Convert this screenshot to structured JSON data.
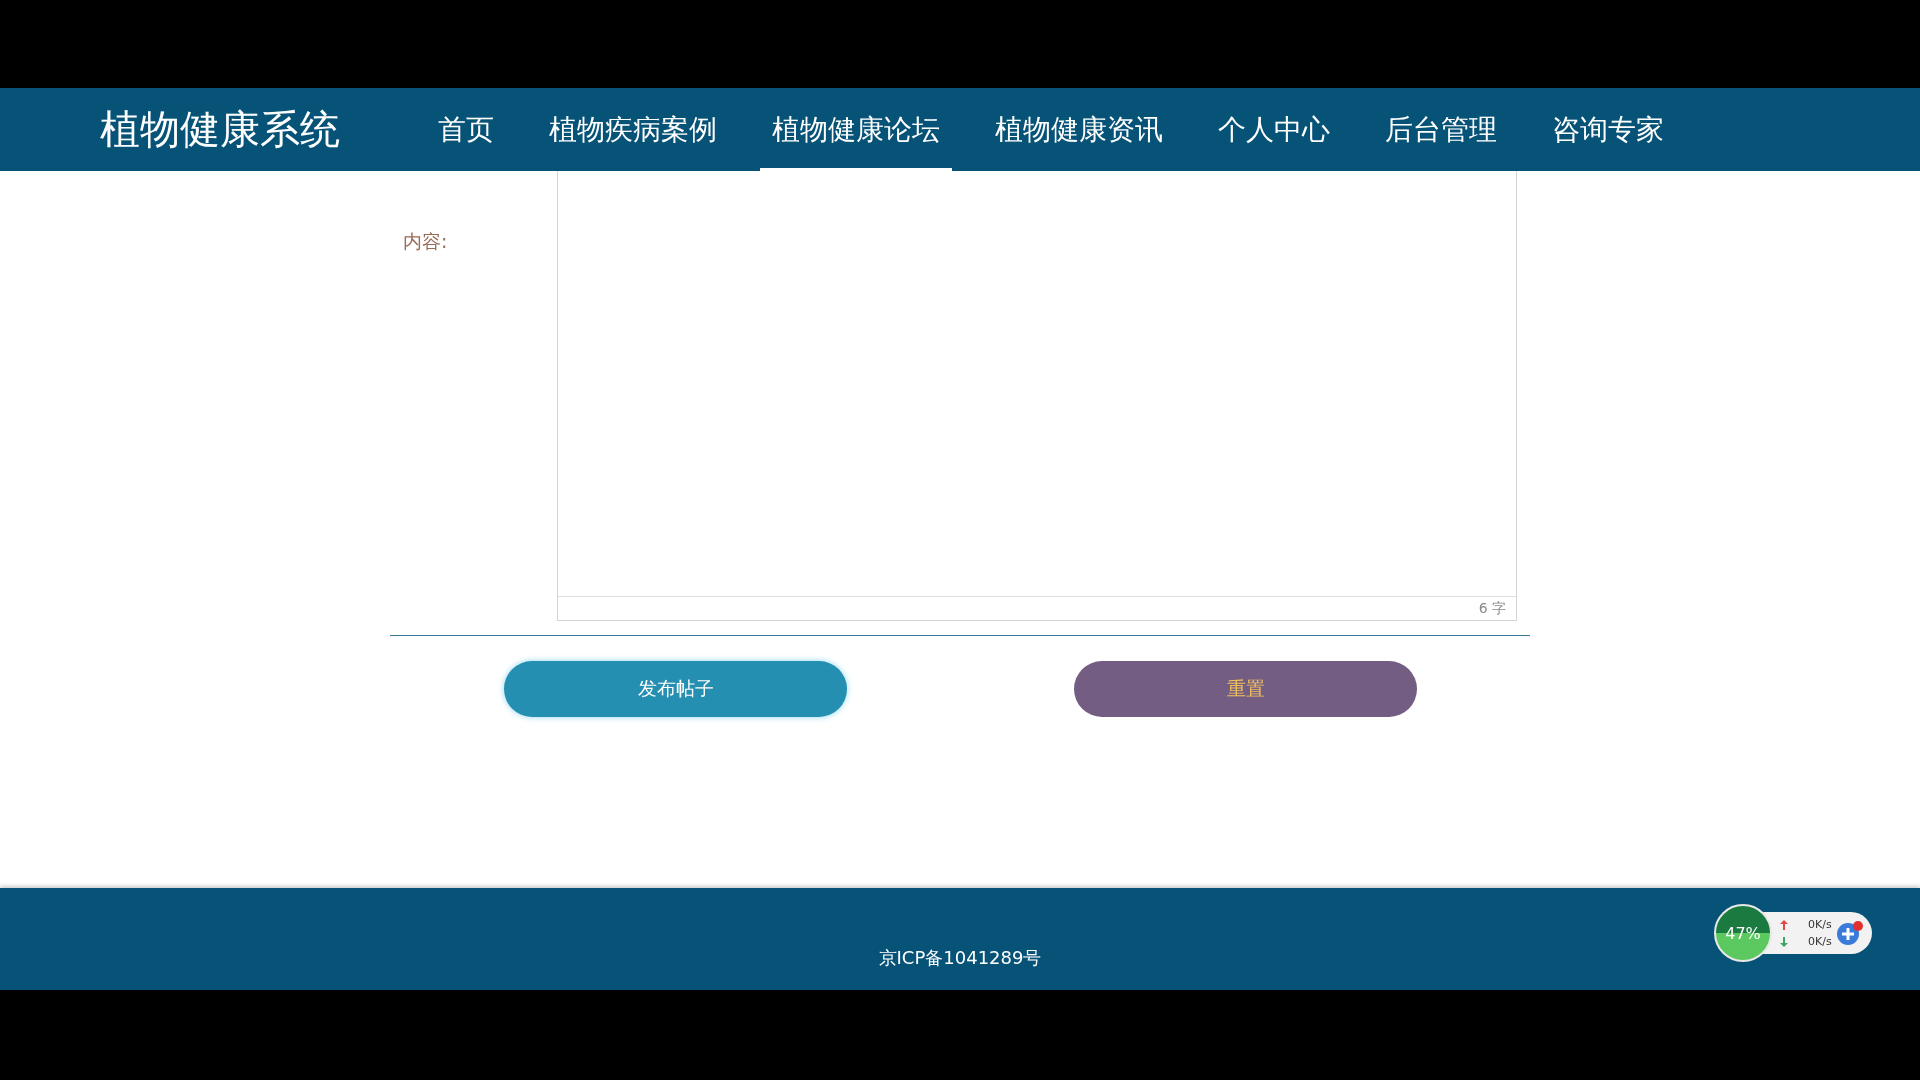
{
  "header": {
    "brand": "植物健康系统",
    "nav": [
      {
        "label": "首页",
        "selected": false
      },
      {
        "label": "植物疾病案例",
        "selected": false
      },
      {
        "label": "植物健康论坛",
        "selected": true
      },
      {
        "label": "植物健康资讯",
        "selected": false
      },
      {
        "label": "个人中心",
        "selected": false
      },
      {
        "label": "后台管理",
        "selected": false
      },
      {
        "label": "咨询专家",
        "selected": false
      }
    ]
  },
  "form": {
    "content_label": "内容:",
    "word_count": "6 字",
    "buttons": [
      {
        "kind": "primary",
        "label": "发布帖子"
      },
      {
        "kind": "reset",
        "label": "重置"
      }
    ]
  },
  "footer": {
    "icp": "京ICP备1041289号"
  },
  "speed_widget": {
    "memory": "47%",
    "upload": "0K/s",
    "download": "0K/s"
  }
}
